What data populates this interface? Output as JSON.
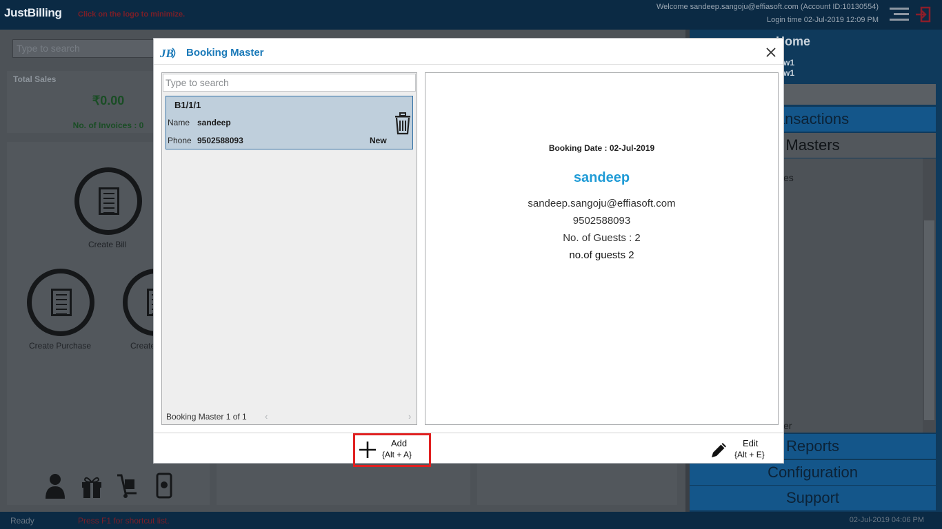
{
  "app": {
    "logo_text": "JustBilling",
    "logo_hint": "Click on the logo to minimize.",
    "welcome": "Welcome sandeep.sangoju@effiasoft.com (Account ID:10130554)",
    "login_time": "Login time  02-Jul-2019 12:09 PM"
  },
  "background": {
    "search_placeholder": "Type to search",
    "total_sales_title": "Total Sales",
    "total_sales_value": "₹0.00",
    "invoices_text": "No. of Invoices : 0",
    "tiles": [
      "Create Bill",
      "Create Purchase",
      "Create"
    ]
  },
  "right_menu": {
    "home": "Home",
    "w1a": "w1",
    "w1b": "w1",
    "transactions": "ansactions",
    "masters": "Masters",
    "partial_es": "es",
    "partial_er": "er",
    "reports": "Reports",
    "configuration": "Configuration",
    "support": "Support"
  },
  "status_bar": {
    "ready": "Ready",
    "press_hint": "Press F1 for shortcut list.",
    "datetime": "02-Jul-2019 04:06 PM"
  },
  "dialog": {
    "title": "Booking Master",
    "search_placeholder": "Type to search",
    "bookings": [
      {
        "id": "B1/1/1",
        "name_label": "Name",
        "name": "sandeep",
        "phone_label": "Phone",
        "phone": "9502588093",
        "status": "New"
      }
    ],
    "list_count": "Booking Master 1 of 1",
    "detail": {
      "booking_date": "Booking Date : 02-Jul-2019",
      "name": "sandeep",
      "email": "sandeep.sangoju@effiasoft.com",
      "phone": "9502588093",
      "guests": "No. of Guests : 2",
      "notes": "no.of guests 2"
    },
    "add_button": {
      "label": "Add",
      "shortcut": "{Alt + A}"
    },
    "edit_button": {
      "label": "Edit",
      "shortcut": "{Alt + E}"
    }
  },
  "colors": {
    "accent": "#1a79b8",
    "highlight": "#e02020",
    "selected_row": "#bfcfdc",
    "name_blue": "#1f9bd6"
  },
  "icons": [
    "document-icon",
    "trash-icon",
    "close-icon",
    "plus-icon",
    "pencil-icon",
    "menu-icon",
    "logout-icon"
  ]
}
